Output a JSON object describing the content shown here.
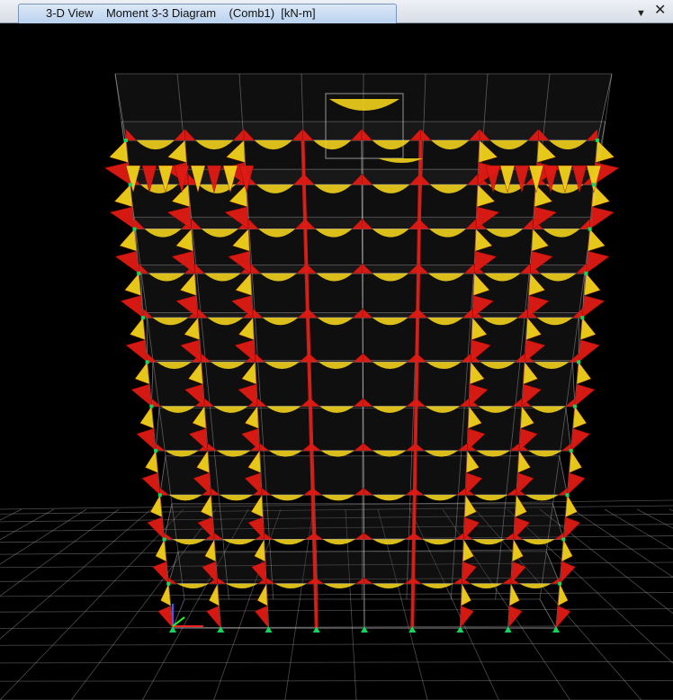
{
  "window": {
    "tab_title": "3-D View    Moment 3-3 Diagram    (Comb1)  [kN-m]",
    "menu_icon": "dropdown-arrow-icon",
    "close_icon": "close-icon"
  },
  "view": {
    "stories": 11,
    "bays": 8,
    "colors": {
      "background": "#000000",
      "frame": "#b8b8b8",
      "moment_positive": "#f2d21c",
      "moment_negative": "#e01b14",
      "support": "#14d65a",
      "ground_grid": "#8a8a8a",
      "axis_x": "#ff2020",
      "axis_y": "#20ff20",
      "axis_z": "#3060ff"
    }
  }
}
